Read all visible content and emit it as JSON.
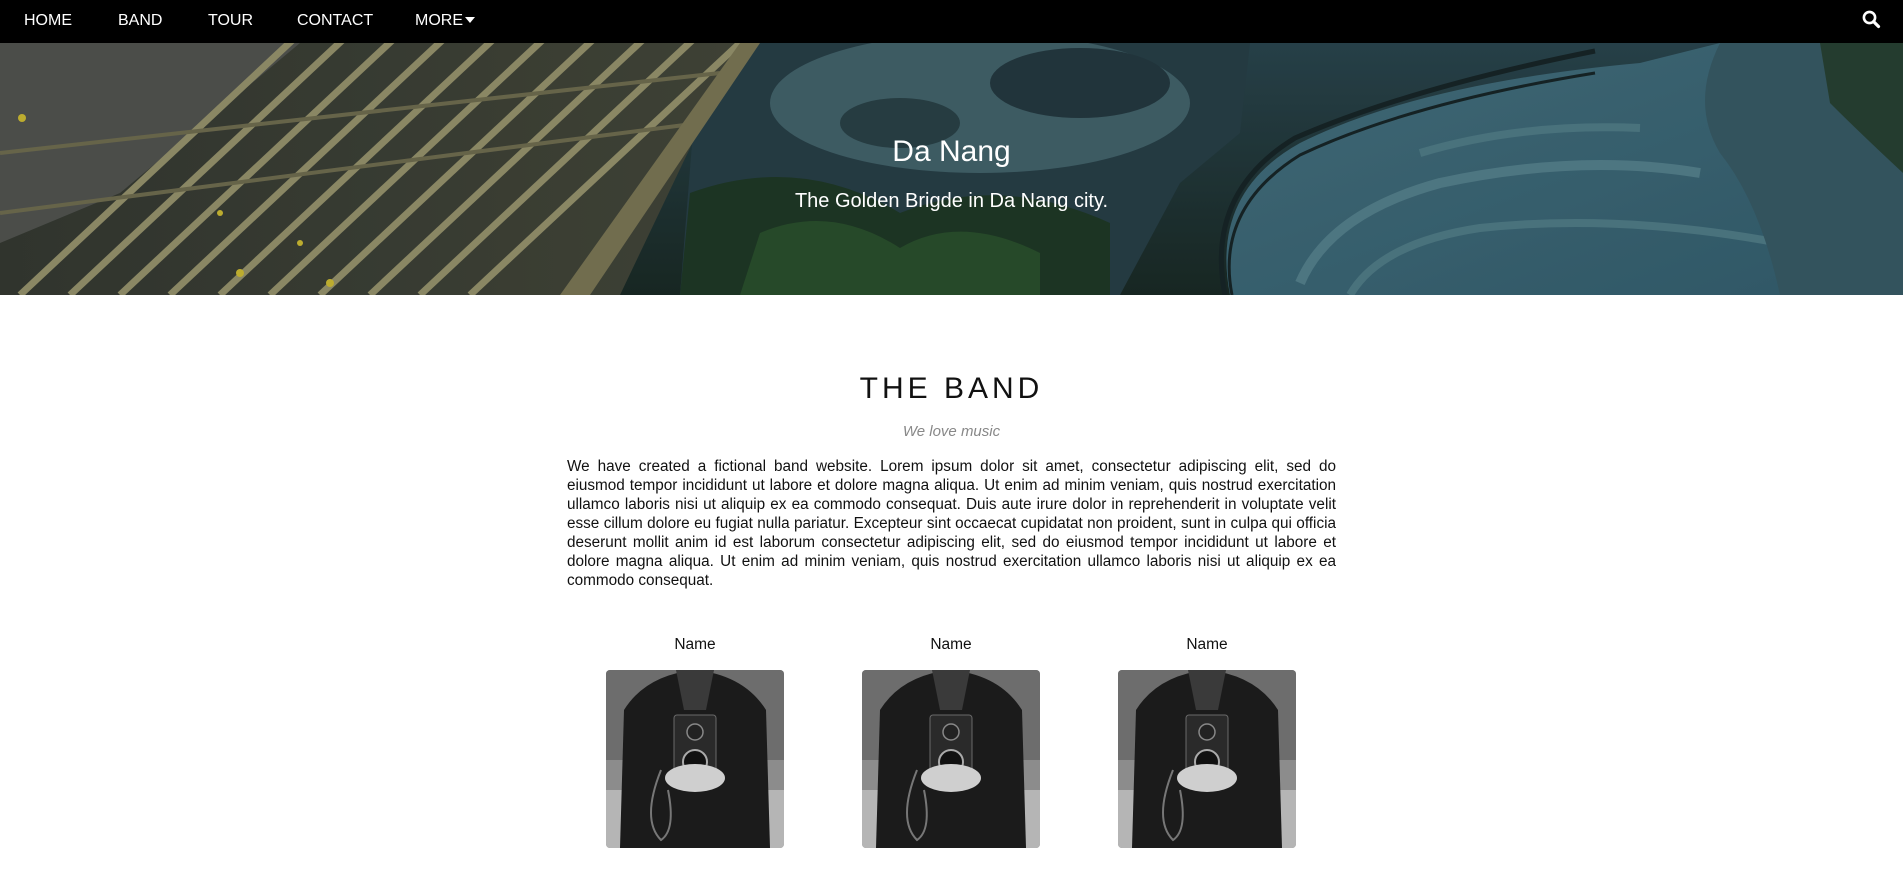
{
  "nav": {
    "items": [
      {
        "label": "HOME"
      },
      {
        "label": "BAND"
      },
      {
        "label": "TOUR"
      },
      {
        "label": "CONTACT"
      },
      {
        "label": "MORE"
      }
    ],
    "search_icon": "search-icon",
    "more_icon": "caret-down-icon"
  },
  "hero": {
    "title": "Da Nang",
    "subtitle": "The Golden Brigde in Da Nang city."
  },
  "band": {
    "title": "THE BAND",
    "tagline": "We love music",
    "description": "We have created a fictional band website. Lorem ipsum dolor sit amet, consectetur adipiscing elit, sed do eiusmod tempor incididunt ut labore et dolore magna aliqua. Ut enim ad minim veniam, quis nostrud exercitation ullamco laboris nisi ut aliquip ex ea commodo consequat. Duis aute irure dolor in reprehenderit in voluptate velit esse cillum dolore eu fugiat nulla pariatur. Excepteur sint occaecat cupidatat non proident, sunt in culpa qui officia deserunt mollit anim id est laborum consectetur adipiscing elit, sed do eiusmod tempor incididunt ut labore et dolore magna aliqua. Ut enim ad minim veniam, quis nostrud exercitation ullamco laboris nisi ut aliquip ex ea commodo consequat.",
    "members": [
      {
        "name": "Name"
      },
      {
        "name": "Name"
      },
      {
        "name": "Name"
      }
    ]
  },
  "colors": {
    "nav_bg": "#000000",
    "nav_text": "#ffffff",
    "tagline": "#888888"
  }
}
